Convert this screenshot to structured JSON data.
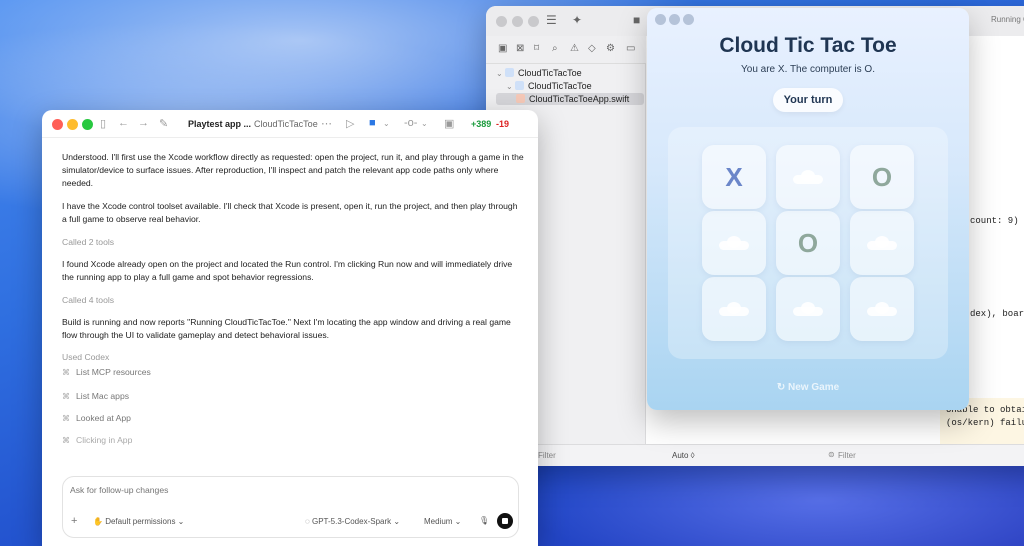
{
  "xcode": {
    "tree": [
      {
        "label": "CloudTicTacToe"
      },
      {
        "label": "CloudTicTacToe"
      },
      {
        "label": "CloudTicTacToeApp.swift"
      }
    ],
    "status_right": "Running C",
    "code_lines": [
      "count: 9)",
      "dex), board["
    ],
    "console_lines": [
      "Unable to obtain",
      "(os/kern) failure"
    ],
    "bottom": {
      "filter_left": "Filter",
      "auto_label": "Auto ◊",
      "filter_right": "Filter"
    }
  },
  "game": {
    "title": "Cloud Tic Tac Toe",
    "subtitle": "You are X. The computer is O.",
    "turn": "Your turn",
    "board": [
      "X",
      "",
      "O",
      "",
      "O",
      "",
      "",
      "",
      ""
    ],
    "new_game": "New Game"
  },
  "chat": {
    "title": "Playtest app ...",
    "subtitle": "CloudTicTacToe",
    "diff_add": "+389",
    "diff_del": "-19",
    "paragraphs": [
      "Understood. I'll first use the Xcode workflow directly as requested: open the project, run it, and play through a game in the simulator/device to surface issues. After reproduction, I'll inspect and patch the relevant app code paths only where needed.",
      "I have the Xcode control toolset available. I'll check that Xcode is present, open it, run the project, and then play through a full game to observe real behavior.",
      "I found Xcode already open on the project and located the Run control. I'm clicking Run now and will immediately drive the running app to play a full game and spot behavior regressions.",
      "Build is running and now reports \"Running CloudTicTacToe.\" Next I'm locating the app window and driving a real game flow through the UI to validate gameplay and detect behavioral issues."
    ],
    "called_2": "Called 2 tools",
    "called_4": "Called 4 tools",
    "used_codex": "Used Codex",
    "tools": [
      "List MCP resources",
      "List Mac apps",
      "Looked at App",
      "Clicking in App"
    ],
    "composer": {
      "placeholder": "Ask for follow-up changes",
      "permissions": "Default permissions",
      "model": "GPT-5.3-Codex-Spark",
      "effort": "Medium"
    }
  }
}
